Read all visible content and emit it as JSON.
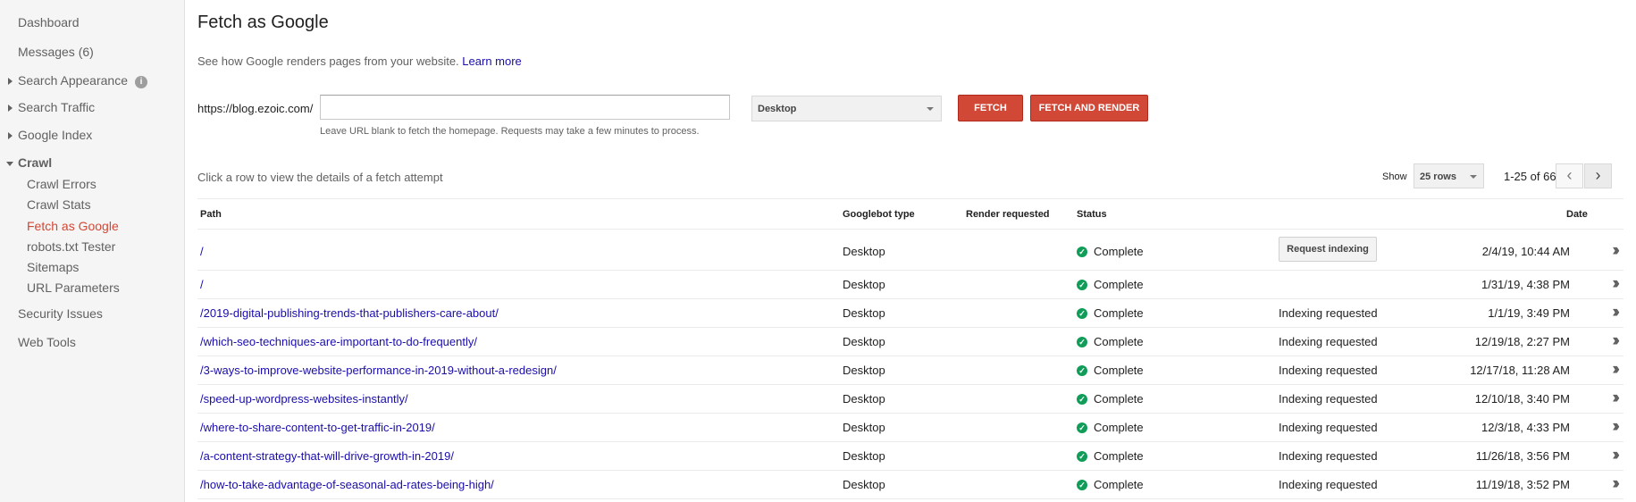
{
  "sidebar": {
    "items": [
      {
        "label": "Dashboard"
      },
      {
        "label": "Messages (6)"
      },
      {
        "label": "Search Appearance",
        "info_icon": "info-icon"
      },
      {
        "label": "Search Traffic"
      },
      {
        "label": "Google Index"
      },
      {
        "label": "Crawl"
      },
      {
        "label": "Security Issues"
      },
      {
        "label": "Web Tools"
      }
    ],
    "crawl_sub": [
      {
        "label": "Crawl Errors"
      },
      {
        "label": "Crawl Stats"
      },
      {
        "label": "Fetch as Google",
        "active": true
      },
      {
        "label": "robots.txt Tester"
      },
      {
        "label": "Sitemaps"
      },
      {
        "label": "URL Parameters"
      }
    ]
  },
  "header": {
    "title": "Fetch as Google",
    "description": "See how Google renders pages from your website.",
    "learn_more": "Learn more"
  },
  "fetch_form": {
    "url_prefix": "https://blog.ezoic.com/",
    "url_value": "",
    "hint": "Leave URL blank to fetch the homepage. Requests may take a few minutes to process.",
    "device": "Desktop",
    "fetch_label": "FETCH",
    "fetch_render_label": "FETCH AND RENDER"
  },
  "table_controls": {
    "instructions": "Click a row to view the details of a fetch attempt",
    "show_label": "Show",
    "rows_value": "25 rows",
    "page_count": "1-25 of 66",
    "prev_icon": "chevron-left-icon",
    "next_icon": "chevron-right-icon"
  },
  "table": {
    "headers": {
      "path": "Path",
      "googlebot_type": "Googlebot type",
      "render_requested": "Render requested",
      "status": "Status",
      "date": "Date"
    },
    "rows": [
      {
        "path": "/",
        "type": "Desktop",
        "status": "Complete",
        "indexing": "Request indexing",
        "indexing_is_button": true,
        "date": "2/4/19, 10:44 AM"
      },
      {
        "path": "/",
        "type": "Desktop",
        "status": "Complete",
        "indexing": "",
        "date": "1/31/19, 4:38 PM"
      },
      {
        "path": "/2019-digital-publishing-trends-that-publishers-care-about/",
        "type": "Desktop",
        "status": "Complete",
        "indexing": "Indexing requested",
        "date": "1/1/19, 3:49 PM"
      },
      {
        "path": "/which-seo-techniques-are-important-to-do-frequently/",
        "type": "Desktop",
        "status": "Complete",
        "indexing": "Indexing requested",
        "date": "12/19/18, 2:27 PM"
      },
      {
        "path": "/3-ways-to-improve-website-performance-in-2019-without-a-redesign/",
        "type": "Desktop",
        "status": "Complete",
        "indexing": "Indexing requested",
        "date": "12/17/18, 11:28 AM"
      },
      {
        "path": "/speed-up-wordpress-websites-instantly/",
        "type": "Desktop",
        "status": "Complete",
        "indexing": "Indexing requested",
        "date": "12/10/18, 3:40 PM"
      },
      {
        "path": "/where-to-share-content-to-get-traffic-in-2019/",
        "type": "Desktop",
        "status": "Complete",
        "indexing": "Indexing requested",
        "date": "12/3/18, 4:33 PM"
      },
      {
        "path": "/a-content-strategy-that-will-drive-growth-in-2019/",
        "type": "Desktop",
        "status": "Complete",
        "indexing": "Indexing requested",
        "date": "11/26/18, 3:56 PM"
      },
      {
        "path": "/how-to-take-advantage-of-seasonal-ad-rates-being-high/",
        "type": "Desktop",
        "status": "Complete",
        "indexing": "Indexing requested",
        "date": "11/19/18, 3:52 PM"
      }
    ]
  },
  "colors": {
    "accent_red": "#d14836",
    "link_blue": "#1a0dab",
    "check_green": "#0f9d58"
  }
}
